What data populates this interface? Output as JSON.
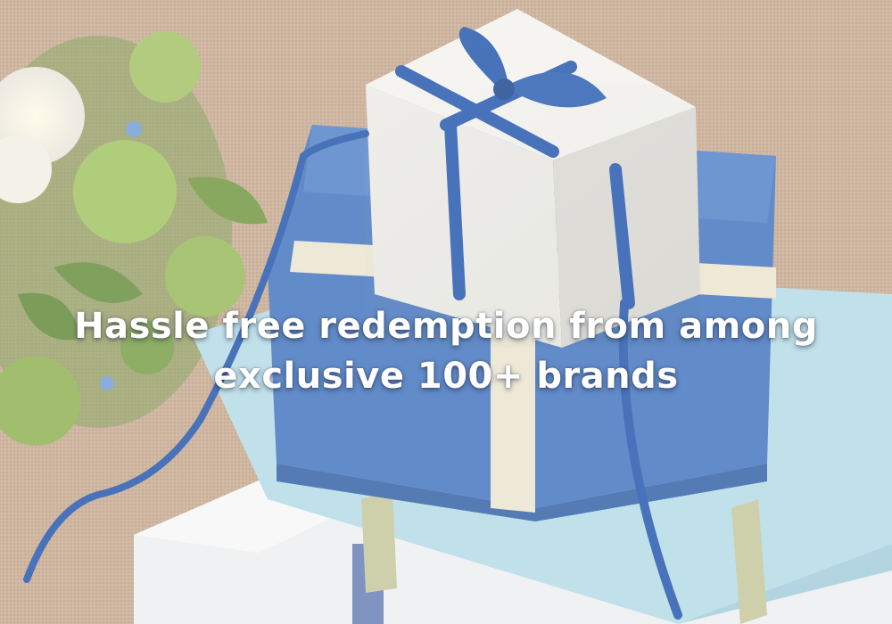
{
  "banner": {
    "headline_line1": "Hassle free redemption from among",
    "headline_line2": "exclusive 100+ brands"
  },
  "palette": {
    "burlap": "#c9ad95",
    "box_blue": "#4f7cc0",
    "box_light_blue": "#b6dbe6",
    "box_white": "#f4f2ee",
    "ribbon_blue": "#2f5fb0",
    "ribbon_cream": "#efe8d6",
    "leaf_green": "#8fb45a"
  }
}
